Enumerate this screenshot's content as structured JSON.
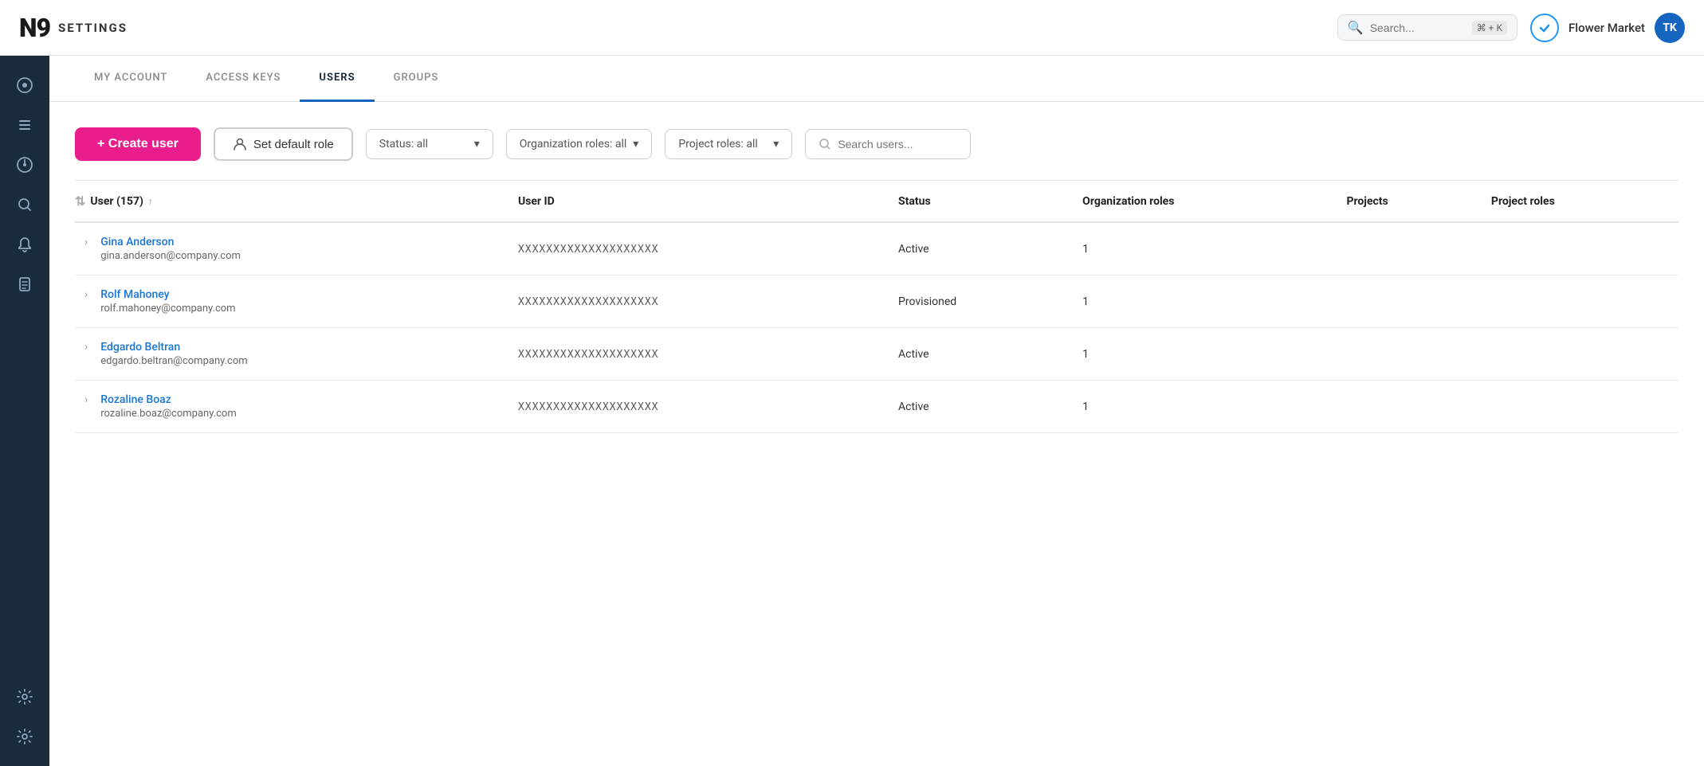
{
  "header": {
    "logo": "N9",
    "app_name": "SETTINGS",
    "search_placeholder": "Search...",
    "shortcut": "⌘ + K",
    "org_name": "Flower Market",
    "avatar_initials": "TK",
    "avatar_bg": "#1565c0"
  },
  "sidebar": {
    "icons": [
      {
        "name": "dashboard-icon",
        "symbol": "⊙"
      },
      {
        "name": "list-icon",
        "symbol": "≡"
      },
      {
        "name": "analytics-icon",
        "symbol": "◎"
      },
      {
        "name": "search-icon",
        "symbol": "⌕"
      },
      {
        "name": "bell-icon",
        "symbol": "🔔"
      },
      {
        "name": "document-icon",
        "symbol": "📄"
      },
      {
        "name": "settings-icon",
        "symbol": "⚙"
      },
      {
        "name": "settings2-icon",
        "symbol": "⚙"
      }
    ]
  },
  "tabs": [
    {
      "id": "my-account",
      "label": "MY ACCOUNT",
      "active": false
    },
    {
      "id": "access-keys",
      "label": "ACCESS KEYS",
      "active": false
    },
    {
      "id": "users",
      "label": "USERS",
      "active": true
    },
    {
      "id": "groups",
      "label": "GROUPS",
      "active": false
    }
  ],
  "toolbar": {
    "create_user_label": "+ Create user",
    "set_default_role_label": "Set default role",
    "status_filter_label": "Status: all",
    "org_roles_filter_label": "Organization roles: all",
    "project_roles_filter_label": "Project roles: all",
    "search_users_placeholder": "Search users..."
  },
  "table": {
    "columns": [
      {
        "id": "user",
        "label": "User (157)",
        "sortable": true
      },
      {
        "id": "user_id",
        "label": "User ID"
      },
      {
        "id": "status",
        "label": "Status"
      },
      {
        "id": "org_roles",
        "label": "Organization roles"
      },
      {
        "id": "projects",
        "label": "Projects"
      },
      {
        "id": "project_roles",
        "label": "Project roles"
      }
    ],
    "rows": [
      {
        "name": "Gina Anderson",
        "email": "gina.anderson@company.com",
        "user_id": "XXXXXXXXXXXXXXXXXXXX",
        "status": "Active",
        "org_roles": "1",
        "projects": "",
        "project_roles": ""
      },
      {
        "name": "Rolf Mahoney",
        "email": "rolf.mahoney@company.com",
        "user_id": "XXXXXXXXXXXXXXXXXXXX",
        "status": "Provisioned",
        "org_roles": "1",
        "projects": "",
        "project_roles": ""
      },
      {
        "name": "Edgardo Beltran",
        "email": "edgardo.beltran@company.com",
        "user_id": "XXXXXXXXXXXXXXXXXXXX",
        "status": "Active",
        "org_roles": "1",
        "projects": "",
        "project_roles": ""
      },
      {
        "name": "Rozaline Boaz",
        "email": "rozaline.boaz@company.com",
        "user_id": "XXXXXXXXXXXXXXXXXXXX",
        "status": "Active",
        "org_roles": "1",
        "projects": "",
        "project_roles": ""
      }
    ]
  }
}
